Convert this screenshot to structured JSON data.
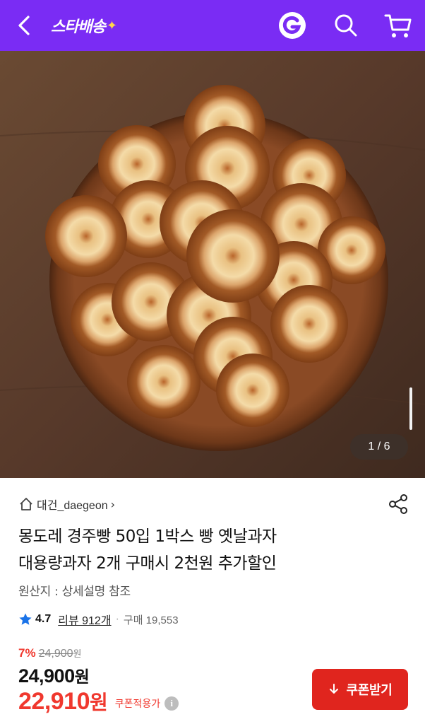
{
  "header": {
    "logo_text": "스타배송",
    "logo_star": "✦",
    "bg_color": "#7a2cf4"
  },
  "gallery": {
    "page_indicator": "1 / 6"
  },
  "seller": {
    "name": "대건_daegeon",
    "chevron": "›"
  },
  "product": {
    "title_line1": "몽도레 경주빵 50입 1박스 빵 옛날과자",
    "title_line2": "대용량과자 2개 구매시 2천원 추가할인",
    "origin": "원산지 : 상세설명 참조",
    "rating": "4.7",
    "review_label": "리뷰 912개",
    "separator": "·",
    "purchase_label": "구매 19,553"
  },
  "pricing": {
    "discount_pct": "7%",
    "original_price": "24,900",
    "original_won": "원",
    "price": "24,900",
    "price_won": "원",
    "coupon_price": "22,910",
    "coupon_won": "원",
    "coupon_note": "쿠폰적용가",
    "info_icon": "i",
    "accent_color": "#f0382e"
  },
  "actions": {
    "coupon_button": "쿠폰받기"
  }
}
